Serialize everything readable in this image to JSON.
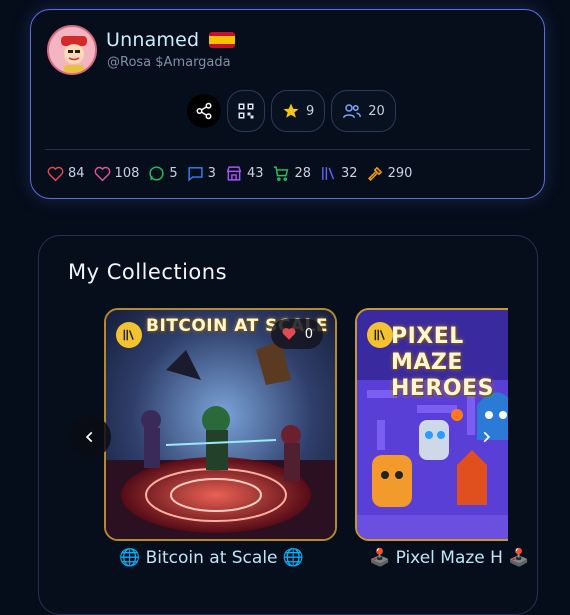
{
  "profile": {
    "name": "Unnamed",
    "handle": "@Rosa $Amargada",
    "flag_icon": "spain-flag-icon",
    "avatar_icon": "cartoon-avatar-icon"
  },
  "actions": {
    "share_icon": "share-icon",
    "qr_icon": "qr-code-icon",
    "stars_count": "9",
    "followers_count": "20"
  },
  "stats": [
    {
      "icon": "heart-outline-icon",
      "value": "84",
      "color": "#e5484d"
    },
    {
      "icon": "heart-outline-icon",
      "value": "108",
      "color": "#e0559f"
    },
    {
      "icon": "chat-bubble-icon",
      "value": "5",
      "color": "#22c55e"
    },
    {
      "icon": "message-square-icon",
      "value": "3",
      "color": "#3b82f6"
    },
    {
      "icon": "store-icon",
      "value": "43",
      "color": "#a855f7"
    },
    {
      "icon": "cart-icon",
      "value": "28",
      "color": "#22c55e"
    },
    {
      "icon": "library-icon",
      "value": "32",
      "color": "#6366f1"
    },
    {
      "icon": "hammer-icon",
      "value": "290",
      "color": "#f59e0b"
    }
  ],
  "collections": {
    "title": "My Collections",
    "items": [
      {
        "art_title": "BITCOIN AT SCALE",
        "likes": "0",
        "caption": "🌐 Bitcoin at Scale 🌐"
      },
      {
        "art_title": "PIXEL MAZE HEROES",
        "caption": "🕹️ Pixel Maze H 🕹️"
      }
    ]
  },
  "colors": {
    "accent_border": "#5b6fd6",
    "card_gold": "#b48a2e",
    "caption": "#bfe4f6"
  }
}
